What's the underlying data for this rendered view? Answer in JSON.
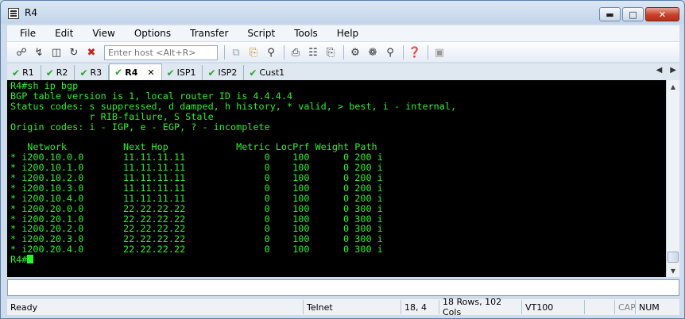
{
  "window": {
    "title": "R4"
  },
  "menu": [
    "File",
    "Edit",
    "View",
    "Options",
    "Transfer",
    "Script",
    "Tools",
    "Help"
  ],
  "toolbar": {
    "host_placeholder": "Enter host <Alt+R>",
    "icons": [
      "connect-icon",
      "quick-connect-icon",
      "connect-tab-icon",
      "reconnect-icon",
      "disconnect-icon",
      "copy-icon",
      "paste-icon",
      "find-icon",
      "print-icon",
      "print-setup-icon",
      "printer-icon",
      "session-options-icon",
      "global-options-icon",
      "keymap-icon",
      "help-icon",
      "sftp-icon"
    ]
  },
  "tabs": [
    {
      "label": "R1",
      "active": false
    },
    {
      "label": "R2",
      "active": false
    },
    {
      "label": "R3",
      "active": false
    },
    {
      "label": "R4",
      "active": true
    },
    {
      "label": "ISP1",
      "active": false
    },
    {
      "label": "ISP2",
      "active": false
    },
    {
      "label": "Cust1",
      "active": false
    }
  ],
  "terminal": {
    "lines": [
      "R4#sh ip bgp",
      "BGP table version is 1, local router ID is 4.4.4.4",
      "Status codes: s suppressed, d damped, h history, * valid, > best, i - internal,",
      "              r RIB-failure, S Stale",
      "Origin codes: i - IGP, e - EGP, ? - incomplete",
      "",
      "   Network          Next Hop            Metric LocPrf Weight Path",
      "* i200.10.0.0       11.11.11.11              0    100      0 200 i",
      "* i200.10.1.0       11.11.11.11              0    100      0 200 i",
      "* i200.10.2.0       11.11.11.11              0    100      0 200 i",
      "* i200.10.3.0       11.11.11.11              0    100      0 200 i",
      "* i200.10.4.0       11.11.11.11              0    100      0 200 i",
      "* i200.20.0.0       22.22.22.22              0    100      0 300 i",
      "* i200.20.1.0       22.22.22.22              0    100      0 300 i",
      "* i200.20.2.0       22.22.22.22              0    100      0 300 i",
      "* i200.20.3.0       22.22.22.22              0    100      0 300 i",
      "* i200.20.4.0       22.22.22.22              0    100      0 300 i"
    ],
    "prompt": "R4#",
    "text_color": "#2cf02c",
    "background": "#000000"
  },
  "status": {
    "state": "Ready",
    "protocol": "Telnet",
    "cursor_pos": "18,  4",
    "size": "18 Rows, 102 Cols",
    "emulation": "VT100",
    "cap": "CAP",
    "num": "NUM"
  }
}
